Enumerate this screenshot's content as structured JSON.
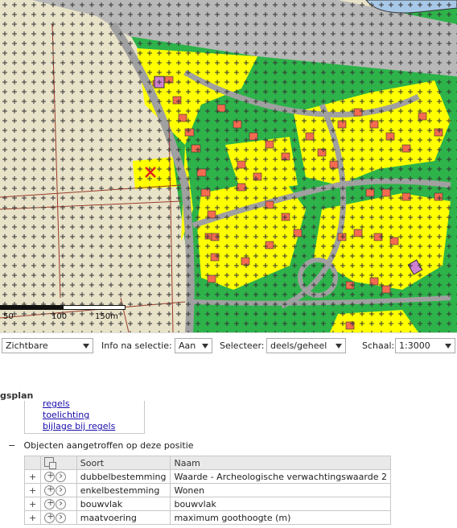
{
  "scale_bar": {
    "labels": [
      "50",
      "100",
      "150m"
    ]
  },
  "toolbar": {
    "layer_select": "Zichtbare",
    "info_label": "Info na selectie:",
    "info_value": "Aan",
    "select_label": "Selecteer:",
    "select_value": "deels/geheel",
    "scale_label": "Schaal:",
    "scale_value": "1:3000"
  },
  "panel": {
    "title_fragment": "gsplan",
    "links": [
      "regels",
      "toelichting",
      "bijlage bij regels"
    ],
    "objects_section": {
      "toggle": "−",
      "label": "Objecten aangetroffen op deze positie",
      "columns": [
        "Soort",
        "Naam"
      ],
      "rows": [
        {
          "expander": "+",
          "soort": "dubbelbestemming",
          "naam": "Waarde - Archeologische verwachtingswaarde 2"
        },
        {
          "expander": "+",
          "soort": "enkelbestemming",
          "naam": "Wonen"
        },
        {
          "expander": "+",
          "soort": "bouwvlak",
          "naam": "bouwvlak"
        },
        {
          "expander": "+",
          "soort": "maatvoering",
          "naam": "maximum goothoogte (m)"
        }
      ]
    }
  },
  "colors": {
    "residential": "#ffff00",
    "green": "#2db34a",
    "road": "#a0a0a0",
    "building": "#f46b50",
    "water": "#a8c8e8",
    "agricultural": "#e8e2c8",
    "link": "#1a0dab"
  }
}
